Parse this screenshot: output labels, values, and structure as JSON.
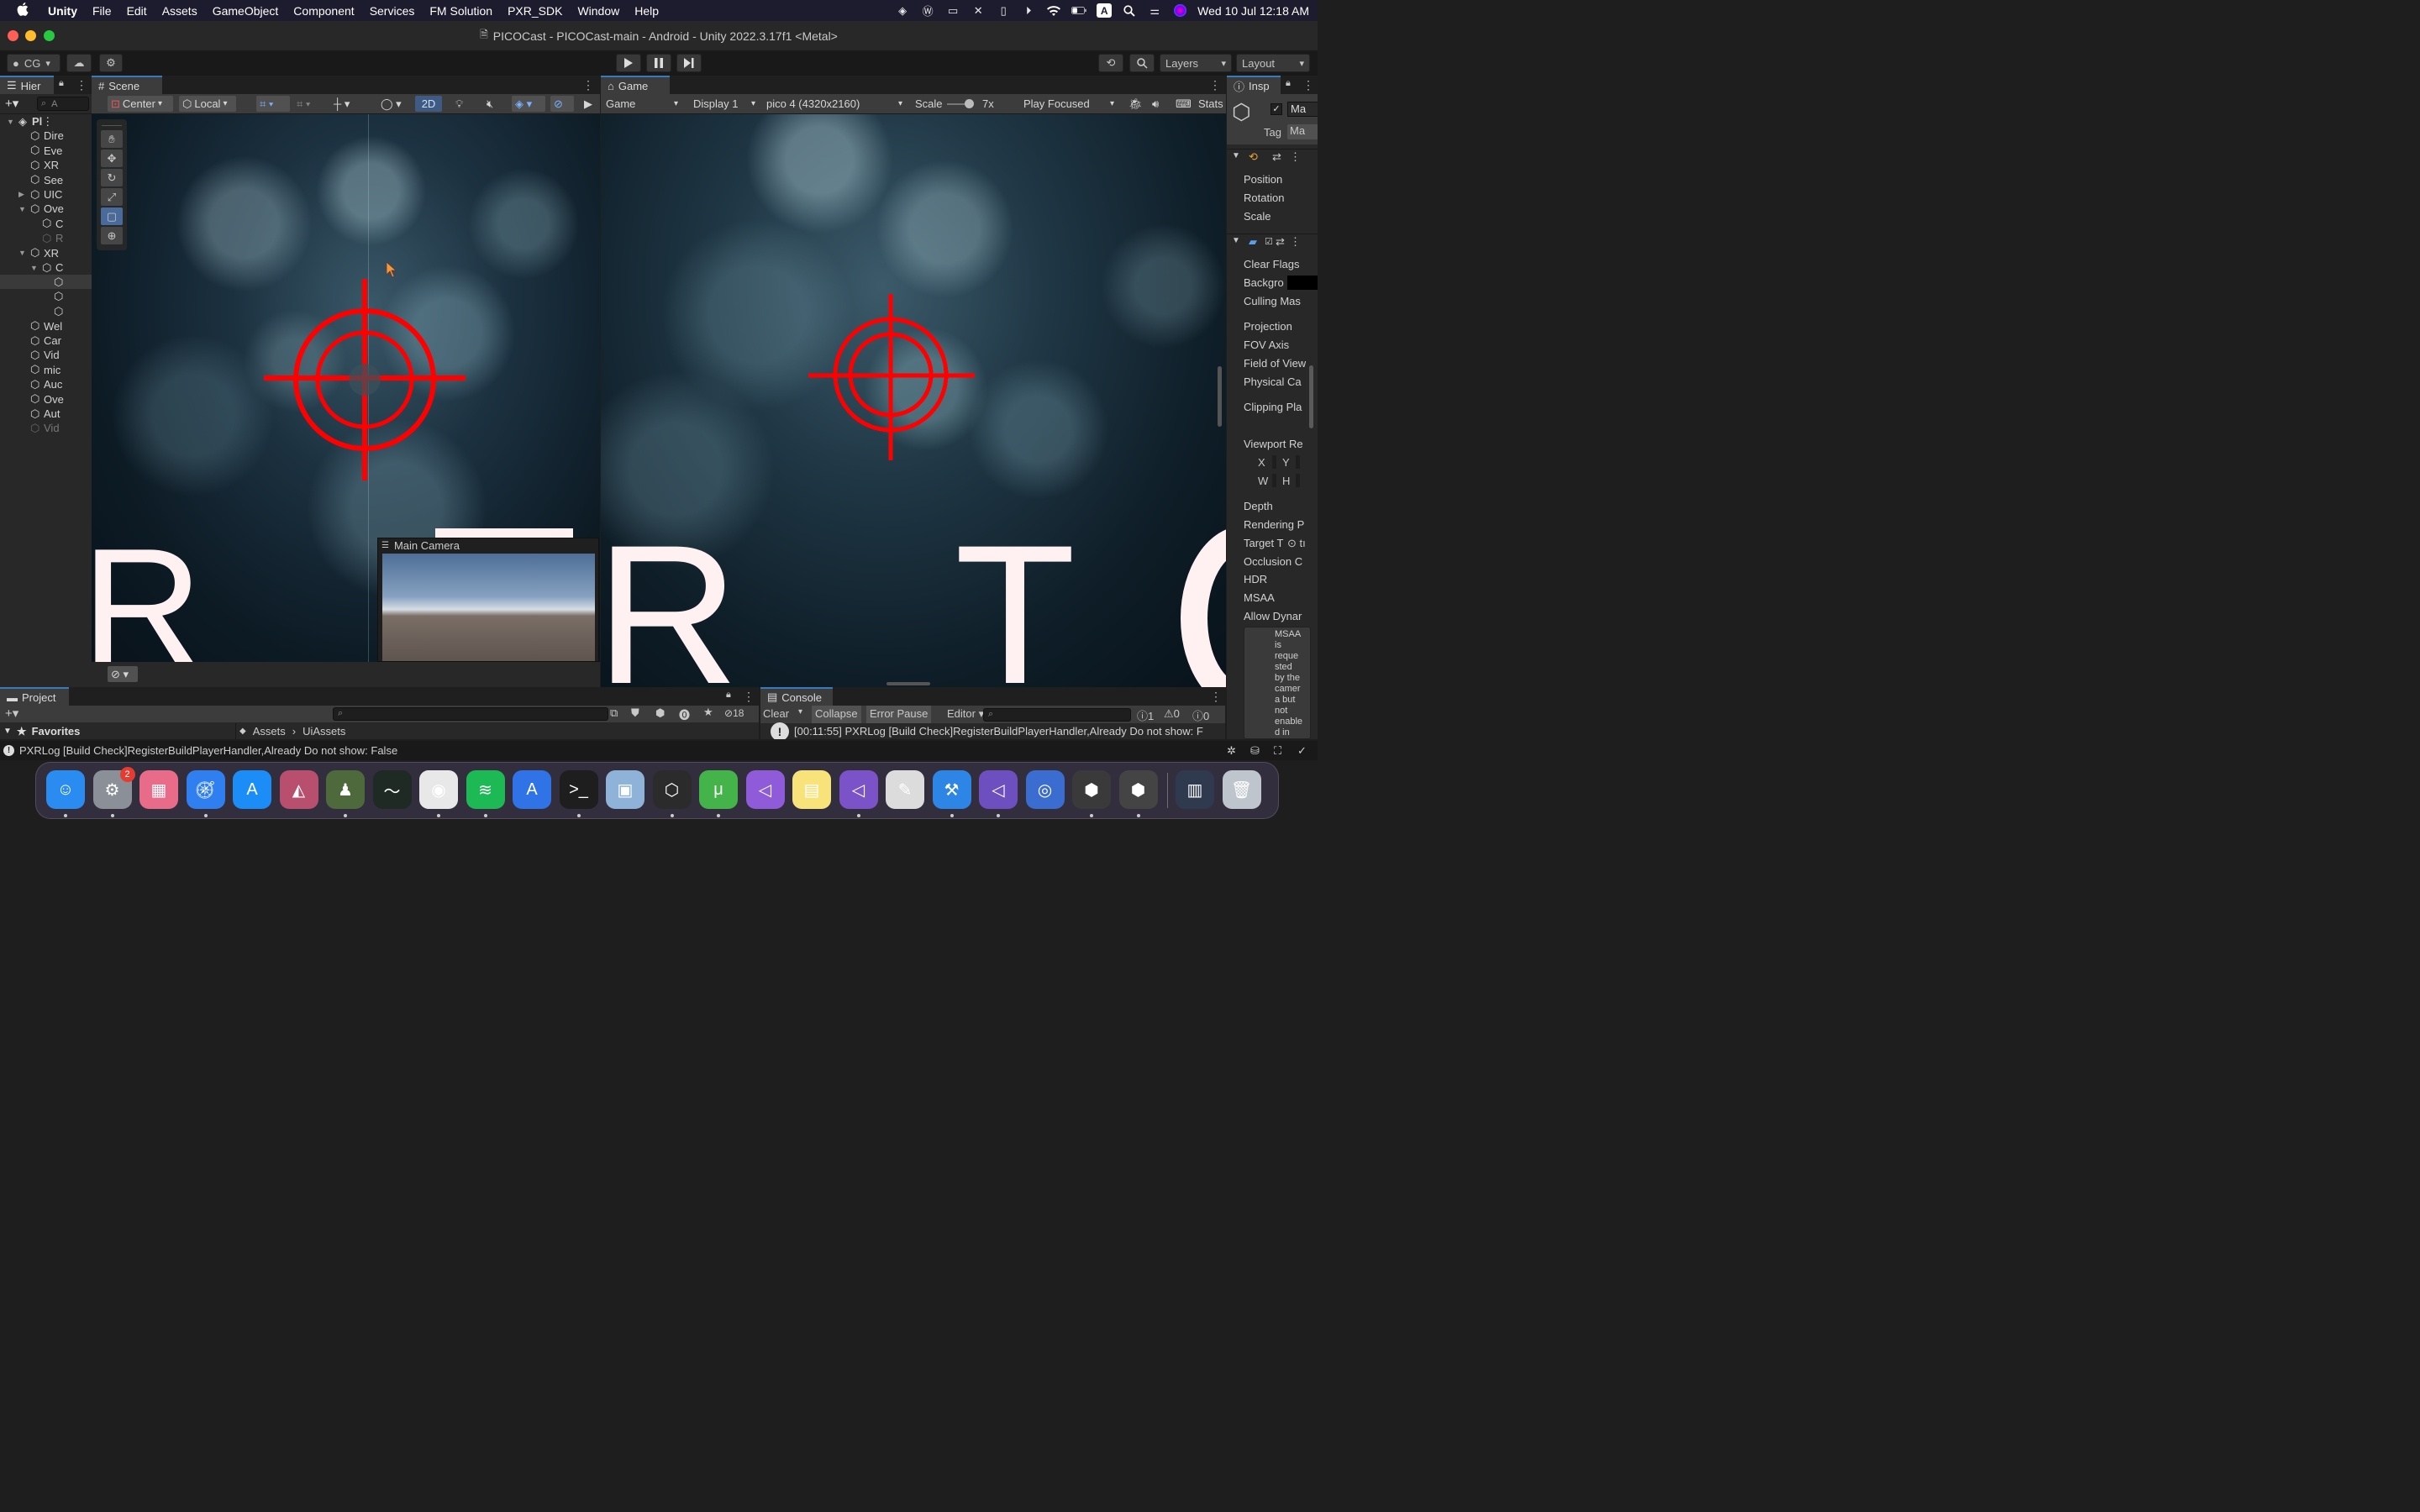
{
  "menubar": {
    "items": [
      "Unity",
      "File",
      "Edit",
      "Assets",
      "GameObject",
      "Component",
      "Services",
      "FM Solution",
      "PXR_SDK",
      "Window",
      "Help"
    ],
    "input_badge": "A",
    "clock": "Wed 10 Jul  12:18 AM"
  },
  "window": {
    "title": "PICOCast - PICOCast-main - Android - Unity 2022.3.17f1 <Metal>"
  },
  "toolbar": {
    "account": "CG",
    "layers": "Layers",
    "layout": "Layout"
  },
  "hierarchy": {
    "tab": "Hier",
    "search_placeholder": "A",
    "rows": [
      {
        "label": "Pl",
        "depth": 0,
        "expand": "▼",
        "scene": true
      },
      {
        "label": "Dire",
        "depth": 1,
        "expand": ""
      },
      {
        "label": "Eve",
        "depth": 1,
        "expand": ""
      },
      {
        "label": "XR",
        "depth": 1,
        "expand": ""
      },
      {
        "label": "See",
        "depth": 1,
        "expand": ""
      },
      {
        "label": "UIC",
        "depth": 1,
        "expand": "▶"
      },
      {
        "label": "Ove",
        "depth": 1,
        "expand": "▼"
      },
      {
        "label": "C",
        "depth": 2,
        "expand": ""
      },
      {
        "label": "R",
        "depth": 2,
        "expand": "",
        "dim": true
      },
      {
        "label": "XR",
        "depth": 1,
        "expand": "▼"
      },
      {
        "label": "C",
        "depth": 2,
        "expand": "▼"
      },
      {
        "label": "",
        "depth": 3,
        "expand": "",
        "selected": true
      },
      {
        "label": "",
        "depth": 3,
        "expand": ""
      },
      {
        "label": "",
        "depth": 3,
        "expand": ""
      },
      {
        "label": "Wel",
        "depth": 1,
        "expand": ""
      },
      {
        "label": "Car",
        "depth": 1,
        "expand": ""
      },
      {
        "label": "Vid",
        "depth": 1,
        "expand": ""
      },
      {
        "label": "mic",
        "depth": 1,
        "expand": ""
      },
      {
        "label": "Auc",
        "depth": 1,
        "expand": ""
      },
      {
        "label": "Ove",
        "depth": 1,
        "expand": ""
      },
      {
        "label": "Aut",
        "depth": 1,
        "expand": ""
      },
      {
        "label": "Vid",
        "depth": 1,
        "expand": "",
        "dim": true
      }
    ]
  },
  "scene": {
    "tab": "Scene",
    "pivot": "Center",
    "space": "Local",
    "mode_2d": "2D",
    "letters": [
      "R"
    ],
    "camera_preview_title": "Main Camera"
  },
  "game": {
    "tab": "Game",
    "view": "Game",
    "display": "Display 1",
    "resolution": "pico 4 (4320x2160)",
    "scale_label": "Scale",
    "scale_value": "7x",
    "play_mode": "Play Focused",
    "stats": "Stats",
    "letters": [
      "R",
      "T"
    ]
  },
  "inspector": {
    "tab": "Insp",
    "name_value": "Ma",
    "tag_label": "Tag",
    "tag_value": "Ma",
    "transform": [
      "Position",
      "Rotation",
      "Scale"
    ],
    "camera_fields": [
      "Clear Flags",
      "Backgro",
      "Culling Mas",
      "Projection",
      "FOV Axis",
      "Field of View",
      "Physical Ca",
      "Clipping Pla",
      "Viewport Re",
      "Depth",
      "Rendering P",
      "Target T",
      "Occlusion C",
      "HDR",
      "MSAA",
      "Allow Dynar"
    ],
    "viewport_xy": [
      "X",
      "Y"
    ],
    "viewport_wh": [
      "W",
      "H"
    ],
    "target_suffix": "⊙ tı",
    "msaa_warning": [
      "MSAA",
      "is",
      "reque",
      "sted",
      "by the",
      "camer",
      "a but",
      "not",
      "enable",
      "d in"
    ]
  },
  "project": {
    "tab": "Project",
    "favorites": "Favorites",
    "breadcrumb": [
      "Assets",
      "UiAssets"
    ],
    "hidden_count": "18"
  },
  "console": {
    "tab": "Console",
    "clear": "Clear",
    "collapse": "Collapse",
    "error_pause": "Error Pause",
    "editor": "Editor",
    "count_log": "1",
    "count_warn": "0",
    "count_err": "0",
    "entry": "[00:11:55] PXRLog [Build Check]RegisterBuildPlayerHandler,Already Do not show: F"
  },
  "statusbar": {
    "message": "PXRLog [Build Check]RegisterBuildPlayerHandler,Already Do not show: False"
  },
  "dock": {
    "apps": [
      "finder-icon",
      "system-settings-icon",
      "launchpad-icon",
      "safari-icon",
      "app-store-icon",
      "affinity-icon",
      "chess-icon",
      "activity-monitor-icon",
      "chrome-icon",
      "spotify-icon",
      "xcode-instruments-icon",
      "terminal-icon",
      "preview-icon",
      "unity-hub-icon",
      "utorrent-icon",
      "visual-studio-icon",
      "notes-icon",
      "visual-studio-icon-2",
      "textedit-icon",
      "xcode-icon",
      "visual-studio-icon-3",
      "quicktime-icon",
      "unity-icon",
      "unity-icon-2",
      "finder-window-icon",
      "trash-icon"
    ],
    "settings_badge": "2"
  },
  "colors": {
    "accent": "#3a79bb",
    "crosshair": "#ff0000",
    "menubar": "#1d1b2e"
  }
}
